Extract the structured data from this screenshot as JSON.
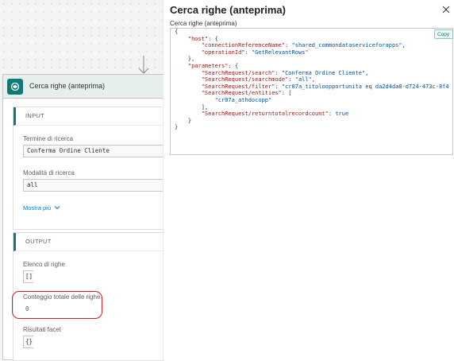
{
  "card": {
    "title": "Cerca righe (anteprima)",
    "icon": "dataverse-icon",
    "input_header": "INPUT",
    "output_header": "OUTPUT",
    "inputs": [
      {
        "label": "Termine di ricerca",
        "value": "Conferma Ordine Cliente"
      },
      {
        "label": "Modalità di ricerca",
        "value": "all"
      }
    ],
    "show_more": "Mostra più",
    "outputs": [
      {
        "label": "Elenco di righe",
        "value": "[]"
      },
      {
        "label": "Conteggio totale delle righe",
        "value": "0"
      },
      {
        "label": "Risultati facet",
        "value": "{}"
      }
    ],
    "highlight_color": "#d7201f"
  },
  "pane": {
    "title": "Cerca righe (anteprima)",
    "subtitle": "Cerca righe (anteprima)",
    "copy_label": "Copy",
    "close_icon": "close-icon",
    "code_lines": [
      {
        "indent": 0,
        "text": "{"
      },
      {
        "indent": 1,
        "key": "\"host\"",
        "rest": ": {"
      },
      {
        "indent": 2,
        "key": "\"connectionReferenceName\"",
        "rest": ": ",
        "val": "\"shared_commondataserviceforapps\"",
        "tail": ","
      },
      {
        "indent": 2,
        "key": "\"operationId\"",
        "rest": ": ",
        "val": "\"GetRelevantRows\""
      },
      {
        "indent": 1,
        "text": "},"
      },
      {
        "indent": 1,
        "key": "\"parameters\"",
        "rest": ": {"
      },
      {
        "indent": 2,
        "key": "\"SearchRequest/search\"",
        "rest": ": ",
        "val": "\"Conferma Ordine Cliente\"",
        "tail": ","
      },
      {
        "indent": 2,
        "key": "\"SearchRequest/searchmode\"",
        "rest": ": ",
        "val": "\"all\"",
        "tail": ","
      },
      {
        "indent": 2,
        "key": "\"SearchRequest/filter\"",
        "rest": ": ",
        "val": "\"cr07a_titoloopportunita eq da2d4da8-d724-473c-8f4"
      },
      {
        "indent": 2,
        "key": "\"SearchRequest/entities\"",
        "rest": ": ["
      },
      {
        "indent": 3,
        "val": "\"cr07a_athdocopp\""
      },
      {
        "indent": 2,
        "text": "],"
      },
      {
        "indent": 2,
        "key": "\"SearchRequest/returntotalrecordcount\"",
        "rest": ": ",
        "val": "true"
      },
      {
        "indent": 1,
        "text": "}"
      },
      {
        "indent": 0,
        "text": "}"
      }
    ],
    "key_color": "#a31515",
    "value_color": "#0451a5"
  }
}
